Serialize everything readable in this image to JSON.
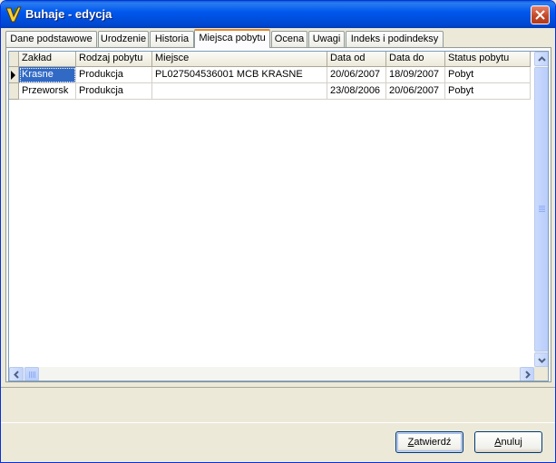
{
  "window": {
    "title": "Buhaje - edycja",
    "icon": "app-v-logo-icon",
    "close_icon": "close-icon"
  },
  "tabs": [
    {
      "label": "Dane podstawowe",
      "active": false
    },
    {
      "label": "Urodzenie",
      "active": false
    },
    {
      "label": "Historia",
      "active": false
    },
    {
      "label": "Miejsca pobytu",
      "active": true
    },
    {
      "label": "Ocena",
      "active": false
    },
    {
      "label": "Uwagi",
      "active": false
    },
    {
      "label": "Indeks i podindeksy",
      "active": false
    }
  ],
  "grid": {
    "columns": [
      "Zakład",
      "Rodzaj pobytu",
      "Miejsce",
      "Data od",
      "Data do",
      "Status pobytu"
    ],
    "rows": [
      [
        "Krasne",
        "Produkcja",
        "PL027504536001 MCB KRASNE",
        "20/06/2007",
        "18/09/2007",
        "Pobyt"
      ],
      [
        "Przeworsk",
        "Produkcja",
        "",
        "23/08/2006",
        "20/06/2007",
        "Pobyt"
      ]
    ],
    "current_row": 0
  },
  "buttons": {
    "confirm": {
      "mnemonic": "Z",
      "rest": "atwierdź"
    },
    "cancel": {
      "mnemonic": "A",
      "rest": "nuluj"
    }
  },
  "colors": {
    "title_bar": "#0058ee",
    "selection": "#316ac5",
    "active_tab_accent": "#e68b2c"
  }
}
